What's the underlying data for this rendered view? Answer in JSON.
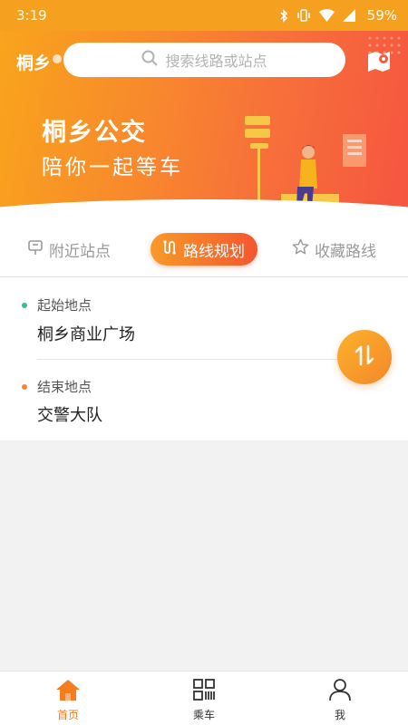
{
  "status_bar": {
    "time": "3:19",
    "battery": "59%"
  },
  "header": {
    "city": "桐乡",
    "search_placeholder": "搜索线路或站点"
  },
  "banner": {
    "title": "桐乡公交",
    "subtitle": "陪你一起等车"
  },
  "tabs": [
    {
      "label": "附近站点",
      "icon": "bus-stop-sign-icon",
      "active": false
    },
    {
      "label": "路线规划",
      "icon": "route-icon",
      "active": true
    },
    {
      "label": "收藏路线",
      "icon": "star-icon",
      "active": false
    }
  ],
  "route": {
    "start_label": "起始地点",
    "start_value": "桐乡商业广场",
    "end_label": "结束地点",
    "end_value": "交警大队",
    "start_dot_color": "#3cb98f",
    "end_dot_color": "#f5873a"
  },
  "bottom_nav": [
    {
      "label": "首页",
      "icon": "home-icon",
      "active": true
    },
    {
      "label": "乘车",
      "icon": "qr-code-icon",
      "active": false
    },
    {
      "label": "我",
      "icon": "user-icon",
      "active": false
    }
  ],
  "colors": {
    "accent": "#f57c1f",
    "banner_start": "#f9a41c",
    "banner_end": "#f55540"
  }
}
